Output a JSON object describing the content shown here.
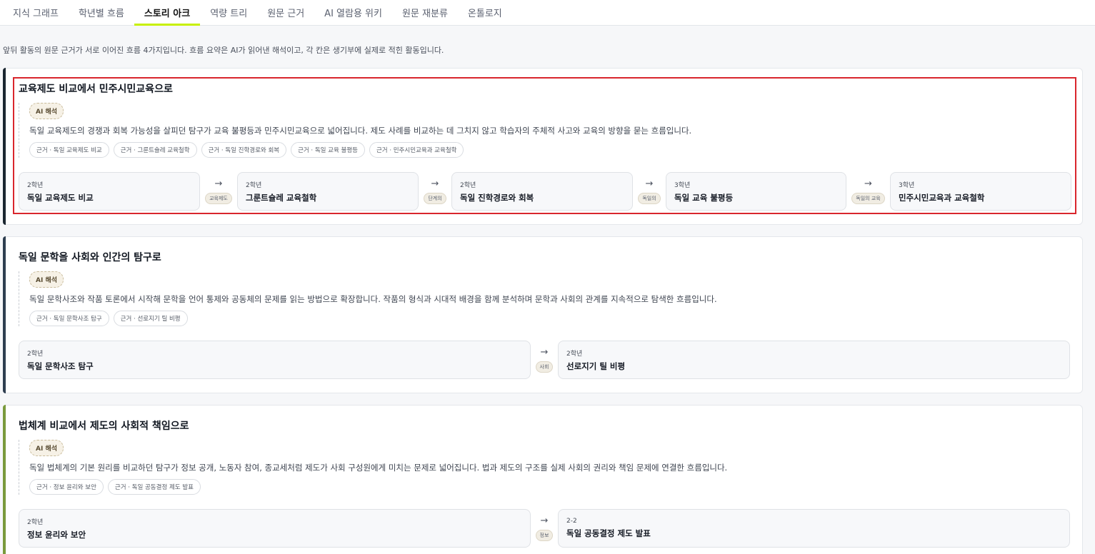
{
  "tabs": [
    {
      "label": "지식 그래프",
      "active": false
    },
    {
      "label": "학년별 흐름",
      "active": false
    },
    {
      "label": "스토리 아크",
      "active": true
    },
    {
      "label": "역량 트리",
      "active": false
    },
    {
      "label": "원문 근거",
      "active": false
    },
    {
      "label": "AI 열람용 위키",
      "active": false
    },
    {
      "label": "원문 재분류",
      "active": false
    },
    {
      "label": "온톨로지",
      "active": false
    }
  ],
  "summary": "앞뒤 활동의 원문 근거가 서로 이어진 흐름 4가지입니다. 흐름 요약은 AI가 읽어낸 해석이고, 각 칸은 생기부에 실제로 적힌 활동입니다.",
  "ai_badge": "AI 해석",
  "arcs": [
    {
      "title": "교육제도 비교에서 민주시민교육으로",
      "interpretation": "독일 교육제도의 경쟁과 회복 가능성을 살피던 탐구가 교육 불평등과 민주시민교육으로 넓어집니다. 제도 사례를 비교하는 데 그치지 않고 학습자의 주체적 사고와 교육의 방향을 묻는 흐름입니다.",
      "evidence": [
        "근거 · 독일 교육제도 비교",
        "근거 · 그룬트슐레 교육철학",
        "근거 · 독일 진학경로와 회복",
        "근거 · 독일 교육 불평등",
        "근거 · 민주시민교육과 교육철학"
      ],
      "steps": [
        {
          "grade": "2학년",
          "title": "독일 교육제도 비교"
        },
        {
          "grade": "2학년",
          "title": "그룬트슐레 교육철학"
        },
        {
          "grade": "2학년",
          "title": "독일 진학경로와 회복"
        },
        {
          "grade": "3학년",
          "title": "독일 교육 불평등"
        },
        {
          "grade": "3학년",
          "title": "민주시민교육과 교육철학"
        }
      ],
      "links": [
        "교육제도",
        "단계의",
        "독일의",
        "독일의 교육"
      ]
    },
    {
      "title": "독일 문학을 사회와 인간의 탐구로",
      "interpretation": "독일 문학사조와 작품 토론에서 시작해 문학을 언어 통제와 공동체의 문제를 읽는 방법으로 확장합니다. 작품의 형식과 시대적 배경을 함께 분석하며 문학과 사회의 관계를 지속적으로 탐색한 흐름입니다.",
      "evidence": [
        "근거 · 독일 문학사조 탐구",
        "근거 · 선로지기 틸 비평"
      ],
      "steps": [
        {
          "grade": "2학년",
          "title": "독일 문학사조 탐구"
        },
        {
          "grade": "2학년",
          "title": "선로지기 틸 비평"
        }
      ],
      "links": [
        "사회"
      ]
    },
    {
      "title": "법체계 비교에서 제도의 사회적 책임으로",
      "interpretation": "독일 법체계의 기본 원리를 비교하던 탐구가 정보 공개, 노동자 참여, 종교세처럼 제도가 사회 구성원에게 미치는 문제로 넓어집니다. 법과 제도의 구조를 실제 사회의 권리와 책임 문제에 연결한 흐름입니다.",
      "evidence": [
        "근거 · 정보 윤리와 보안",
        "근거 · 독일 공동결정 제도 발표"
      ],
      "steps": [
        {
          "grade": "2학년",
          "title": "정보 윤리와 보안"
        },
        {
          "grade": "2-2",
          "title": "독일 공동결정 제도 발표"
        }
      ],
      "links": [
        "정보"
      ]
    }
  ]
}
